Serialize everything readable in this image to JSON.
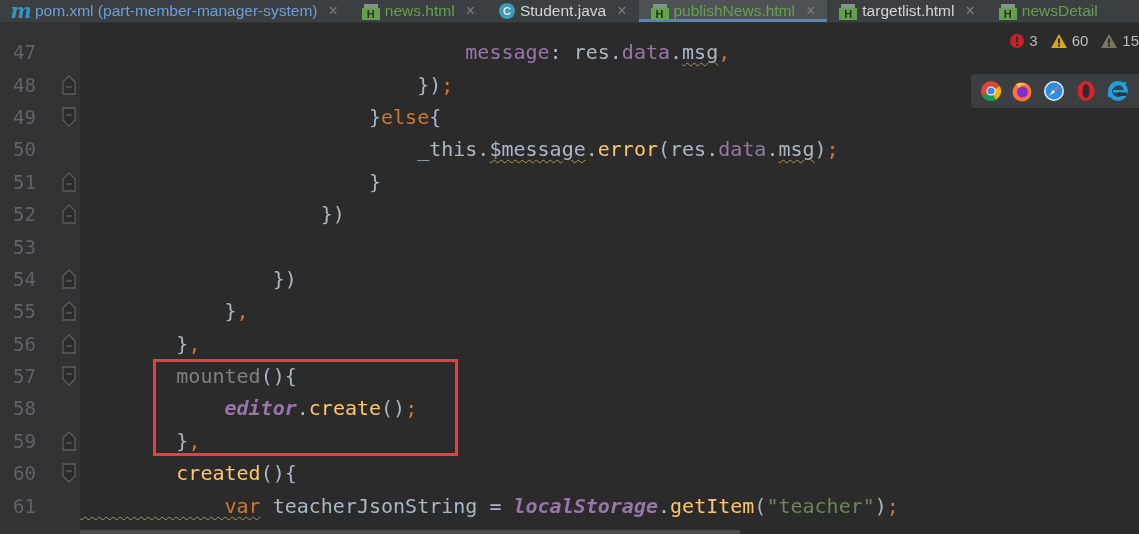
{
  "tabs": [
    {
      "label": "pom.xml (part-member-manager-system)",
      "kind": "maven",
      "icon_text": "m",
      "color": "#6a9fd8",
      "selected": false,
      "close": "×"
    },
    {
      "label": "news.html",
      "kind": "html",
      "icon_text": "H",
      "color": "#62a34a",
      "selected": false,
      "close": "×"
    },
    {
      "label": "Student.java",
      "kind": "class",
      "icon_text": "C",
      "color": "#d4d4d4",
      "selected": false,
      "close": "×"
    },
    {
      "label": "publishNews.html",
      "kind": "html",
      "icon_text": "H",
      "color": "#62a34a",
      "selected": true,
      "close": "×"
    },
    {
      "label": "targetlist.html",
      "kind": "html",
      "icon_text": "H",
      "color": "#d4d4d4",
      "selected": false,
      "close": "×"
    },
    {
      "label": "newsDetail",
      "kind": "html",
      "icon_text": "H",
      "color": "#62a34a",
      "selected": false
    }
  ],
  "inspections": [
    {
      "kind": "error",
      "count": "3"
    },
    {
      "kind": "warning",
      "count": "60"
    },
    {
      "kind": "weak_warning",
      "count": "15"
    }
  ],
  "browsers": [
    {
      "kind": "chrome"
    },
    {
      "kind": "firefox"
    },
    {
      "kind": "safari"
    },
    {
      "kind": "opera"
    },
    {
      "kind": "ie"
    }
  ],
  "code_groups": [
    {
      "highlighted": false,
      "lines": [
        {
          "number": "47",
          "kind": "plain",
          "tokens": [
            {
              "text": "                                message",
              "kind": "field"
            },
            {
              "text": ": res.",
              "kind": "plain"
            },
            {
              "text": "data",
              "kind": "field"
            },
            {
              "text": ".",
              "kind": "plain"
            },
            {
              "text": "msg",
              "kind": "warn_plain"
            },
            {
              "text": ",",
              "kind": "keyword"
            }
          ]
        },
        {
          "number": "48",
          "kind": "fold_end",
          "tokens": [
            {
              "text": "                            })",
              "kind": "plain"
            },
            {
              "text": ";",
              "kind": "keyword"
            }
          ]
        },
        {
          "number": "49",
          "kind": "fold_start",
          "tokens": [
            {
              "text": "                        }",
              "kind": "plain"
            },
            {
              "text": "else",
              "kind": "keyword"
            },
            {
              "text": "{",
              "kind": "plain"
            }
          ]
        },
        {
          "number": "50",
          "kind": "plain",
          "tokens": [
            {
              "text": "                            _this.",
              "kind": "plain"
            },
            {
              "text": "$message",
              "kind": "warn_plain"
            },
            {
              "text": ".",
              "kind": "plain"
            },
            {
              "text": "error",
              "kind": "method"
            },
            {
              "text": "(res.",
              "kind": "plain"
            },
            {
              "text": "data",
              "kind": "field"
            },
            {
              "text": ".",
              "kind": "plain"
            },
            {
              "text": "msg",
              "kind": "warn_plain"
            },
            {
              "text": ")",
              "kind": "plain"
            },
            {
              "text": ";",
              "kind": "keyword"
            }
          ]
        },
        {
          "number": "51",
          "kind": "fold_end",
          "tokens": [
            {
              "text": "                        }",
              "kind": "plain"
            }
          ]
        },
        {
          "number": "52",
          "kind": "fold_end",
          "tokens": [
            {
              "text": "                    })",
              "kind": "plain"
            }
          ]
        },
        {
          "number": "53",
          "kind": "plain"
        },
        {
          "number": "54",
          "kind": "fold_end",
          "tokens": [
            {
              "text": "                })",
              "kind": "plain"
            }
          ]
        },
        {
          "number": "55",
          "kind": "fold_end",
          "tokens": [
            {
              "text": "            }",
              "kind": "plain"
            },
            {
              "text": ",",
              "kind": "keyword"
            }
          ]
        },
        {
          "number": "56",
          "kind": "fold_end",
          "tokens": [
            {
              "text": "        }",
              "kind": "plain"
            },
            {
              "text": ",",
              "kind": "keyword"
            }
          ]
        }
      ]
    },
    {
      "highlighted": true,
      "lines": [
        {
          "number": "57",
          "kind": "fold_start",
          "tokens": [
            {
              "text": "        mounted",
              "kind": "unused"
            },
            {
              "text": "(){",
              "kind": "plain"
            }
          ]
        },
        {
          "number": "58",
          "kind": "plain",
          "tokens": [
            {
              "text": "            editor",
              "kind": "global"
            },
            {
              "text": ".",
              "kind": "plain"
            },
            {
              "text": "create",
              "kind": "method"
            },
            {
              "text": "()",
              "kind": "plain"
            },
            {
              "text": ";",
              "kind": "keyword"
            }
          ]
        },
        {
          "number": "59",
          "kind": "fold_end",
          "tokens": [
            {
              "text": "        }",
              "kind": "plain"
            },
            {
              "text": ",",
              "kind": "keyword"
            }
          ]
        }
      ]
    },
    {
      "highlighted": false,
      "lines": [
        {
          "number": "60",
          "kind": "fold_start",
          "tokens": [
            {
              "text": "        created",
              "kind": "method"
            },
            {
              "text": "(){",
              "kind": "plain"
            }
          ]
        },
        {
          "number": "61",
          "kind": "plain",
          "tokens": [
            {
              "text": "            var",
              "kind": "warn_keyword"
            },
            {
              "text": " teacherJsonString = ",
              "kind": "plain"
            },
            {
              "text": "localStorage",
              "kind": "global"
            },
            {
              "text": ".",
              "kind": "plain"
            },
            {
              "text": "getItem",
              "kind": "method"
            },
            {
              "text": "(",
              "kind": "plain"
            },
            {
              "text": "\"teacher\"",
              "kind": "string"
            },
            {
              "text": ")",
              "kind": "plain"
            },
            {
              "text": ";",
              "kind": "keyword"
            }
          ]
        }
      ]
    }
  ]
}
